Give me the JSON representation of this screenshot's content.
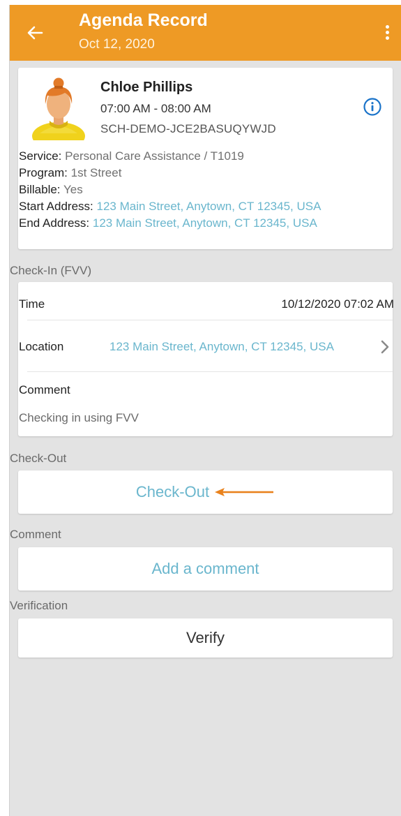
{
  "header": {
    "title": "Agenda Record",
    "subtitle": "Oct 12, 2020"
  },
  "client": {
    "name": "Chloe Phillips",
    "time": "07:00 AM - 08:00 AM",
    "id": "SCH-DEMO-JCE2BASUQYWJD",
    "service_label": "Service:",
    "service_value": "Personal Care Assistance / T1019",
    "program_label": "Program:",
    "program_value": "1st Street",
    "billable_label": "Billable:",
    "billable_value": "Yes",
    "start_label": "Start Address:",
    "start_value": "123 Main Street, Anytown, CT 12345, USA",
    "end_label": "End Address:",
    "end_value": "123 Main Street, Anytown, CT 12345, USA"
  },
  "checkin": {
    "section": "Check-In (FVV)",
    "time_label": "Time",
    "time_value": "10/12/2020 07:02 AM",
    "location_label": "Location",
    "location_value": "123 Main Street, Anytown, CT 12345, USA",
    "comment_label": "Comment",
    "comment_value": "Checking in using FVV"
  },
  "checkout": {
    "section": "Check-Out",
    "button": "Check-Out"
  },
  "comment": {
    "section": "Comment",
    "button": "Add a comment"
  },
  "verification": {
    "section": "Verification",
    "button": "Verify"
  },
  "colors": {
    "header_bg": "#ee9a25",
    "link": "#6ab6cd",
    "info_icon": "#1a73c9",
    "arrow": "#e9821d"
  },
  "icons": [
    "back-arrow-icon",
    "more-vert-icon",
    "avatar-icon",
    "info-icon",
    "chevron-right-icon",
    "annotation-arrow-icon"
  ]
}
